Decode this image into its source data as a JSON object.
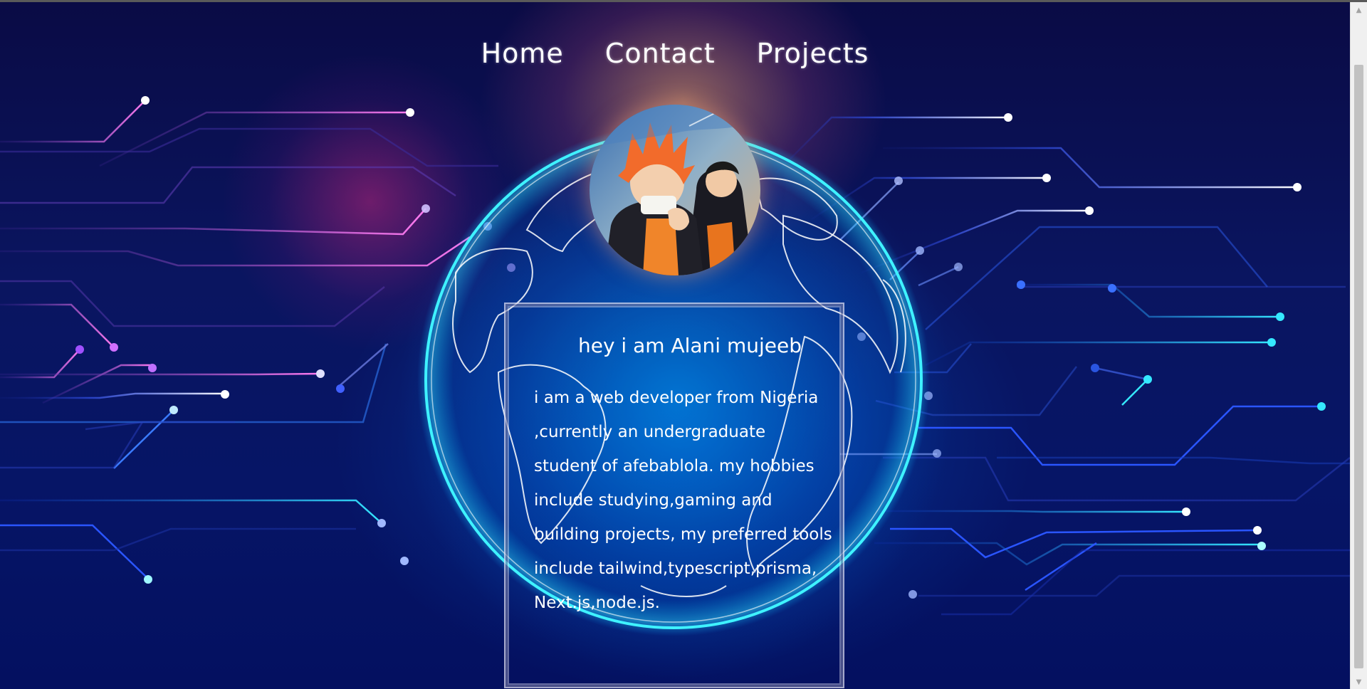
{
  "nav": {
    "items": [
      {
        "label": "Home"
      },
      {
        "label": "Contact"
      },
      {
        "label": "Projects"
      }
    ]
  },
  "profile": {
    "avatar_icon": "anime-avatar-icon",
    "title": "hey i am Alani mujeeb",
    "bio": "i am a web developer from Nigeria ,currently an undergraduate student of afebablola. my hobbies include studying,gaming and building projects, my preferred tools include tailwind,typescript,prisma, Next.js,node.js."
  },
  "scrollbar": {
    "up_icon": "arrow-up-icon",
    "down_icon": "arrow-down-icon"
  },
  "colors": {
    "background": "#05093a",
    "glow_cyan": "#2ee6ff",
    "glow_pink": "#e62882",
    "text": "#ffffff"
  }
}
